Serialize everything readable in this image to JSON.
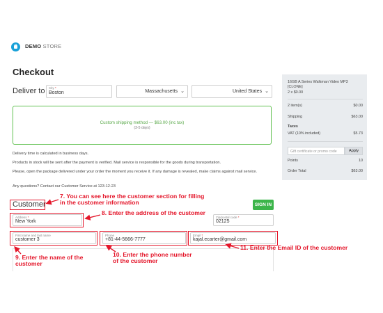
{
  "header": {
    "brand_bold": "DEMO",
    "brand_light": "STORE"
  },
  "page": {
    "title": "Checkout"
  },
  "delivery": {
    "label": "Deliver to",
    "city": {
      "label": "City",
      "value": "Boston"
    },
    "state": {
      "value": "Massachusetts"
    },
    "country": {
      "value": "United States"
    }
  },
  "shipping": {
    "method": "Custom shipping method — $63.00 (inc tax)",
    "time": "(3-5 days)"
  },
  "info_lines": [
    "Delivery time is calculated in business days.",
    "Products in stock will be sent after the payment is verified. Mail service is responsible for the goods during transportation.",
    "Please, open the package delivered under your order the moment you receive it. If any damage is revealed, make claims against mail service.",
    "Any questions? Contact our Customer Service at 123-12-23"
  ],
  "customer": {
    "heading": "Customer",
    "signin_label": "SIGN IN",
    "address": {
      "label": "Address",
      "value": "New York"
    },
    "zip": {
      "label": "Zip/postal code",
      "value": "02125"
    },
    "name": {
      "label": "First name and last name",
      "value": "customer 3"
    },
    "phone": {
      "label": "Phone",
      "value": "+81-44-5666-7777"
    },
    "email": {
      "label": "Email",
      "value": "kajal.ecarter@gmail.com"
    }
  },
  "annotations": {
    "a7": "7. You can see here the customer section for filling in the customer information",
    "a8": "8. Enter the address of the customer",
    "a9": "9. Enter the name of the customer",
    "a10": "10. Enter the phone number of the customer",
    "a11": "11. Enter the Email ID of the customer"
  },
  "summary": {
    "product_name": "16GB A Series Walkman Video MP3 [CLONE]",
    "product_qty_price": "2 x $0.00",
    "items_label": "2 item(s)",
    "items_value": "$0.00",
    "shipping_label": "Shipping",
    "shipping_value": "$63.00",
    "taxes_label": "Taxes",
    "vat_label": "VAT (10% included)",
    "vat_value": "$5.73",
    "gift_placeholder": "Gift certificate or promo code",
    "apply_label": "Apply",
    "points_label": "Points",
    "points_value": "10",
    "total_label": "Order Total",
    "total_value": "$63.00"
  },
  "colors": {
    "accent": "#19a1d8",
    "success": "#3cb54a",
    "annotation": "#e4162a",
    "summary_bg": "#e9ecef"
  }
}
